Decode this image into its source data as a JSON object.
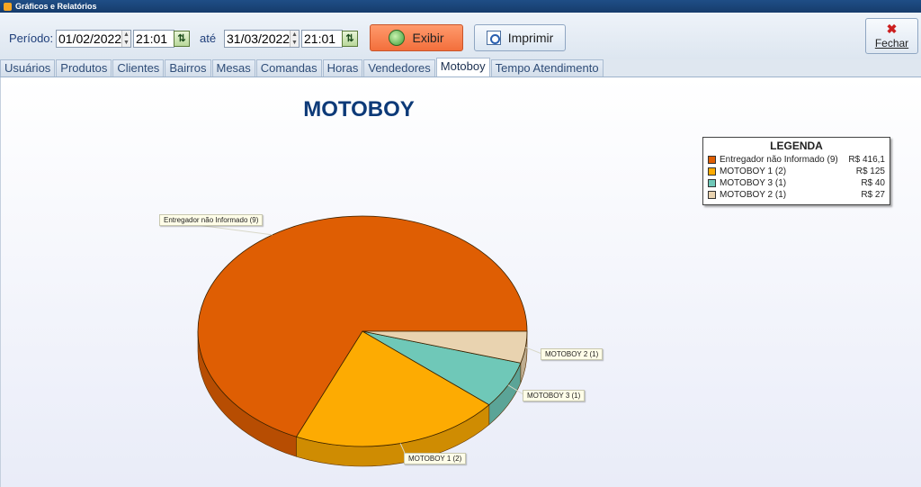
{
  "window": {
    "title": "Gráficos e Relatórios"
  },
  "filters": {
    "period_label": "Período:",
    "start_date": "01/02/2022",
    "start_time": "21:01",
    "until_label": "até",
    "end_date": "31/03/2022",
    "end_time": "21:01"
  },
  "buttons": {
    "show": "Exibir",
    "print": "Imprimir",
    "close_x": "✖",
    "close": "Fechar"
  },
  "tabs": [
    {
      "label": "Usuários",
      "active": false
    },
    {
      "label": "Produtos",
      "active": false
    },
    {
      "label": "Clientes",
      "active": false
    },
    {
      "label": "Bairros",
      "active": false
    },
    {
      "label": "Mesas",
      "active": false
    },
    {
      "label": "Comandas",
      "active": false
    },
    {
      "label": "Horas",
      "active": false
    },
    {
      "label": "Vendedores",
      "active": false
    },
    {
      "label": "Motoboy",
      "active": true
    },
    {
      "label": "Tempo Atendimento",
      "active": false
    }
  ],
  "chart_data": {
    "type": "pie",
    "title": "MOTOBOY",
    "legend_title": "LEGENDA",
    "legend_placement": "top-right",
    "slices": [
      {
        "label": "Entregador não Informado (9)",
        "value": 416.1,
        "value_label": "R$ 416,1",
        "color": "#df5e03"
      },
      {
        "label": "MOTOBOY 1 (2)",
        "value": 125,
        "value_label": "R$ 125",
        "color": "#fdab02"
      },
      {
        "label": "MOTOBOY 3 (1)",
        "value": 40,
        "value_label": "R$ 40",
        "color": "#6fc8b8"
      },
      {
        "label": "MOTOBOY 2 (1)",
        "value": 27,
        "value_label": "R$ 27",
        "color": "#e9d3b0"
      }
    ]
  }
}
